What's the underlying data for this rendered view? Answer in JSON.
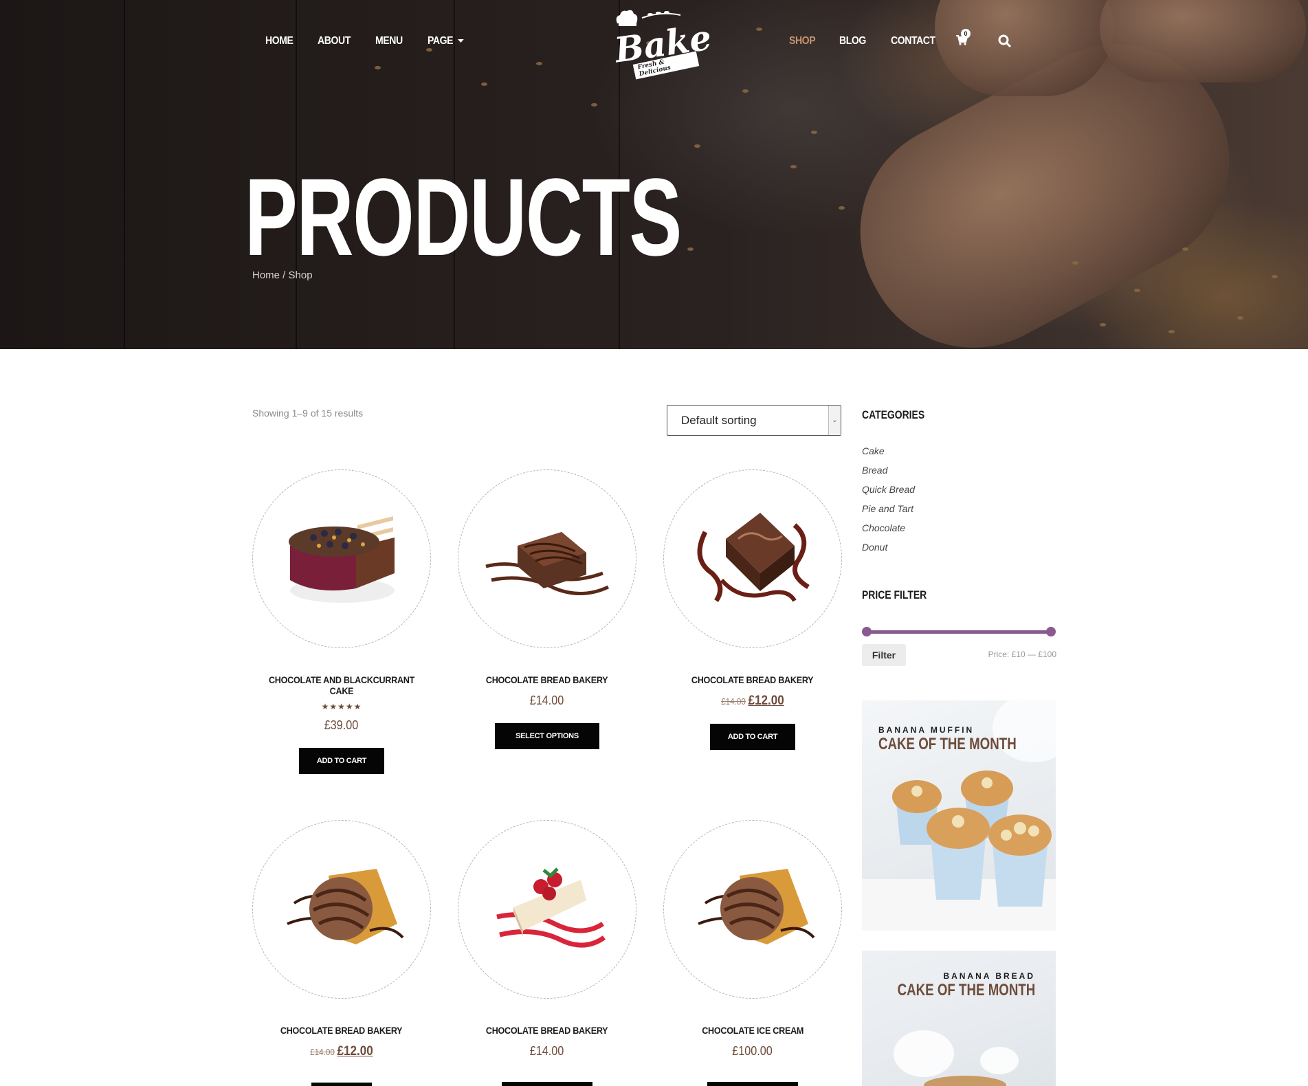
{
  "nav": {
    "left": [
      {
        "label": "HOME"
      },
      {
        "label": "ABOUT"
      },
      {
        "label": "MENU"
      },
      {
        "label": "PAGE"
      }
    ],
    "right": [
      {
        "label": "SHOP",
        "active": true
      },
      {
        "label": "BLOG"
      },
      {
        "label": "CONTACT"
      }
    ],
    "cart_count": "0"
  },
  "logo": {
    "name": "Bake",
    "tagline": "Fresh & Delicious"
  },
  "hero": {
    "title": "PRODUCTS",
    "breadcrumb": {
      "home": "Home",
      "separator": " / ",
      "current": "Shop"
    }
  },
  "shop": {
    "result_count": "Showing 1–9 of 15 results",
    "sort_value": "Default sorting",
    "products": [
      {
        "name": "CHOCOLATE AND BLACKCURRANT CAKE",
        "rating": "★★★★★",
        "price": "£39.00",
        "button": "ADD TO CART",
        "image_icon": "layer-cake-icon"
      },
      {
        "name": "CHOCOLATE BREAD BAKERY",
        "price": "£14.00",
        "button": "SELECT OPTIONS",
        "image_icon": "brownie-icon"
      },
      {
        "name": "CHOCOLATE BREAD BAKERY",
        "old_price": "£14.00",
        "sale_price": "£12.00",
        "button": "ADD TO CART",
        "image_icon": "brownie-icon"
      },
      {
        "name": "CHOCOLATE BREAD BAKERY",
        "old_price": "£14.00",
        "sale_price": "£12.00",
        "image_icon": "ice-cream-icon"
      },
      {
        "name": "CHOCOLATE BREAD BAKERY",
        "price": "£14.00",
        "image_icon": "cheesecake-icon"
      },
      {
        "name": "CHOCOLATE ICE CREAM",
        "price": "£100.00",
        "image_icon": "ice-cream-icon"
      }
    ]
  },
  "sidebar": {
    "categories_title": "CATEGORIES",
    "categories": [
      "Cake",
      "Bread",
      "Quick Bread",
      "Pie and Tart",
      "Chocolate",
      "Donut"
    ],
    "price_filter_title": "PRICE FILTER",
    "filter_button": "Filter",
    "price_range": "Price: £10 — £100",
    "promos": [
      {
        "kicker": "BANANA MUFFIN",
        "title": "CAKE OF THE MONTH"
      },
      {
        "kicker": "BANANA BREAD",
        "title": "CAKE OF THE MONTH"
      }
    ]
  },
  "colors": {
    "accent_brown": "#6e4c3b",
    "active_nav": "#c7936f",
    "slider": "#8a5a8f",
    "button": "#050505"
  }
}
